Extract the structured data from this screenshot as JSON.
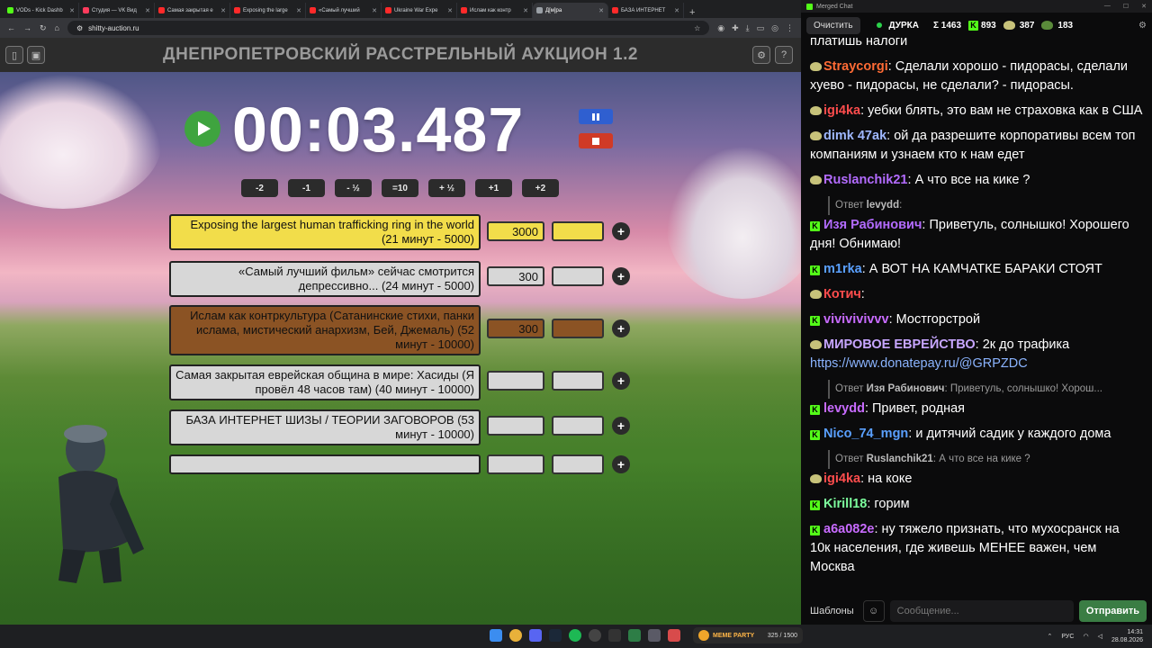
{
  "browser": {
    "tabs": [
      {
        "label": "VODs - Kick Dashb",
        "color": "#53fc18"
      },
      {
        "label": "Студия — VK Вид",
        "color": "#ff3b5c"
      },
      {
        "label": "Самая закрытая е",
        "color": "#ff2a2a"
      },
      {
        "label": "Exposing the large",
        "color": "#ff2a2a"
      },
      {
        "label": "«Самый лучший",
        "color": "#ff2a2a"
      },
      {
        "label": "Ukraine War Expe",
        "color": "#ff2a2a"
      },
      {
        "label": "Ислам как контр",
        "color": "#ff2a2a"
      },
      {
        "label": "Д[м]ра",
        "color": "#9aa0a6"
      },
      {
        "label": "БАЗА ИНТЕРНЕТ",
        "color": "#ff2a2a"
      }
    ],
    "url": "shitty-auction.ru"
  },
  "app": {
    "title": "ДНЕПРОПЕТРОВСКИЙ РАССТРЕЛЬНЫЙ АУКЦИОН 1.2",
    "timer": "00:03.487",
    "adjust_buttons": [
      "-2",
      "-1",
      "- ½",
      "=10",
      "+ ½",
      "+1",
      "+2"
    ],
    "lots": [
      {
        "name": "Exposing the largest human trafficking ring in the world (21 минут - 5000)",
        "amount": "3000",
        "style": "yellow"
      },
      {
        "name": "«Самый лучший фильм» сейчас смотрится депрессивно... (24 минут - 5000)",
        "amount": "300",
        "style": "gray"
      },
      {
        "name": "Ислам как контркультура (Сатанинские стихи, панки ислама, мистический анархизм,  Бей, Джемаль) (52 минут - 10000)",
        "amount": "300",
        "style": "brown"
      },
      {
        "name": "Самая закрытая еврейская община в мире: Хасиды (Я провёл 48 часов там) (40 минут - 10000)",
        "amount": "",
        "style": "gray"
      },
      {
        "name": "БАЗА ИНТЕРНЕТ ШИЗЫ / ТЕОРИИ ЗАГОВОРОВ (53 минут - 10000)",
        "amount": "",
        "style": "gray"
      },
      {
        "name": "",
        "amount": "",
        "style": "gray"
      }
    ]
  },
  "chat": {
    "window_title": "Merged Chat",
    "clear_label": "Очистить",
    "stats": {
      "name": "ДУРКА",
      "sum": "Σ 1463",
      "kick": "893",
      "twitch": "387",
      "vk": "183"
    },
    "messages": [
      {
        "user": "",
        "color": "#ffffff",
        "text": "платишь налоги"
      },
      {
        "user": "Straycorgi",
        "color": "#ff6b35",
        "text": "Сделали хорошо - пидорасы, сделали хуево - пидорасы, не сделали? - пидорасы."
      },
      {
        "user": "igi4ka",
        "color": "#ff4d4d",
        "text": "уебки блять, это вам не страховка как в США"
      },
      {
        "user": "dimk 47ak",
        "color": "#9fb8ff",
        "text": "ой да разрешите корпоративы всем топ компаниям и узнаем кто к нам едет"
      },
      {
        "user": "Ruslanchik21",
        "color": "#b36bff",
        "text": "А что все на кике ?"
      },
      {
        "reply_user": "levydd",
        "reply_text": "",
        "user": "Изя Рабинович",
        "color": "#b36bff",
        "text": "Приветуль, солнышко! Хорошего дня! Обнимаю!"
      },
      {
        "user": "m1rka",
        "color": "#5aa0ff",
        "text": "А ВОТ НА КАМЧАТКЕ БАРАКИ СТОЯТ"
      },
      {
        "user": "Котич",
        "color": "#ff4d4d",
        "text": ""
      },
      {
        "user": "vivivivivvv",
        "color": "#c86bff",
        "text": "Мостгорстрой"
      },
      {
        "user": "МИРОВОЕ ЕВРЕЙСТВО",
        "color": "#c7a6ff",
        "text": "2к до трафика",
        "link": "https://www.donatepay.ru/@GRPZDC"
      },
      {
        "reply_user": "Изя Рабинович",
        "reply_text": "Приветуль, солнышко! Хорош...",
        "user": "levydd",
        "color": "#c86bff",
        "text": "Привет, родная"
      },
      {
        "user": "Nico_74_mgn",
        "color": "#5aa0ff",
        "text": "и дитячий садик у каждого дома"
      },
      {
        "reply_user": "Ruslanchik21",
        "reply_text": "А что все на кике ?",
        "user": "igi4ka",
        "color": "#ff4d4d",
        "text": "на коке"
      },
      {
        "user": "Kirill18",
        "color": "#7dff9e",
        "text": "горим"
      },
      {
        "user": "a6a082e",
        "color": "#c86bff",
        "text": "ну тяжело признать, что мухосранск на 10к населения, где живешь МЕНЕЕ важен, чем Москва"
      }
    ],
    "templates_label": "Шаблоны",
    "input_placeholder": "Сообщение...",
    "send_label": "Отправить"
  },
  "taskbar": {
    "party_label": "MEME PARTY",
    "party_count": "325 / 1500",
    "lang": "РУС",
    "time": "14:31",
    "date": "28.08.2026"
  }
}
